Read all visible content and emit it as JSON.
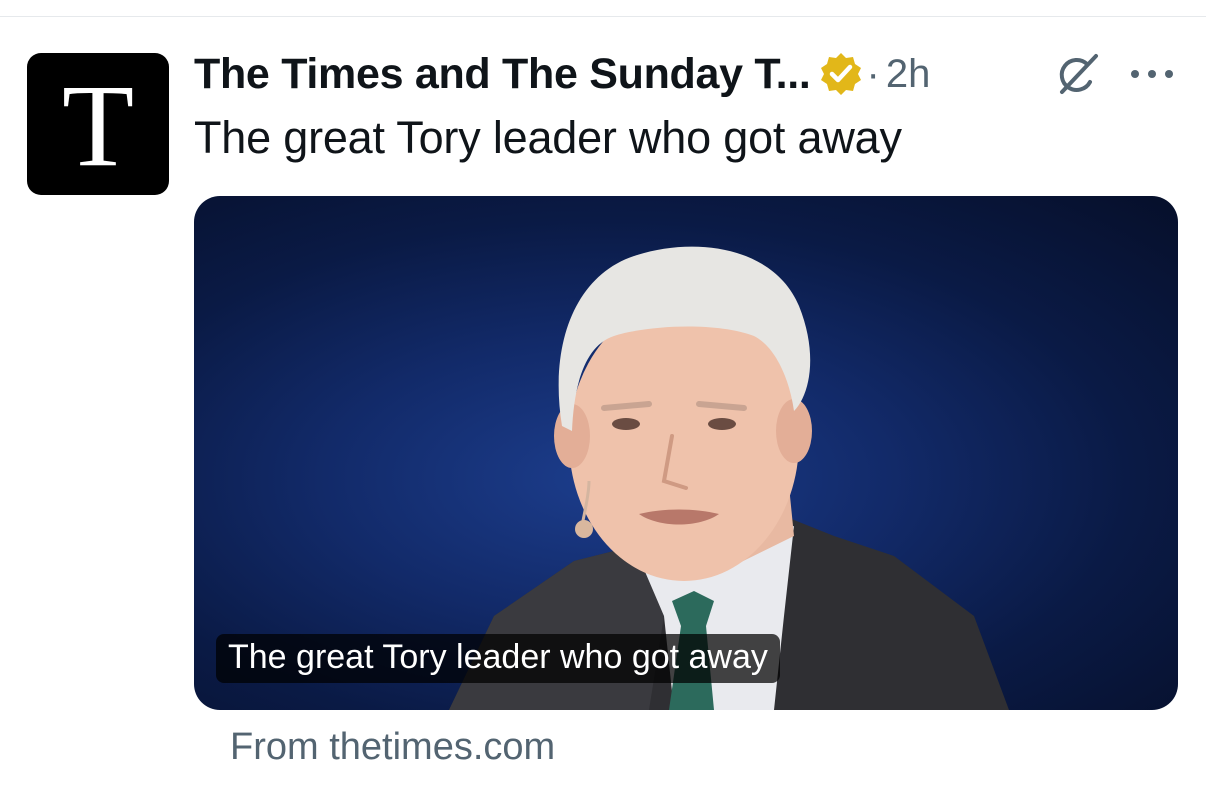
{
  "post": {
    "author": {
      "display_name": "The Times and The Sunday T...",
      "avatar_letter": "T",
      "verified": true,
      "verified_color": "#e2b719"
    },
    "separator": "·",
    "time": "2h",
    "text": "The great Tory leader who got away",
    "icons": {
      "grok": "grok-icon",
      "more": "more-options-icon"
    }
  },
  "card": {
    "caption": "The great Tory leader who got away",
    "source": "From thetimes.com"
  },
  "colors": {
    "text_primary": "#0f1419",
    "text_secondary": "#536471",
    "media_background": "#122a69"
  }
}
